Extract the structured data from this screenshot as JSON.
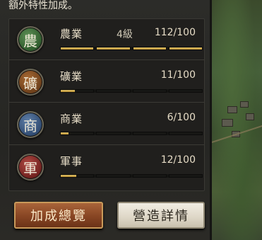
{
  "header": {
    "text": "額外特性加成。"
  },
  "rows": [
    {
      "icon": "農",
      "name": "農業",
      "level": "4級",
      "value": "112/100",
      "progress": 1.0,
      "color": "#3f6b3a"
    },
    {
      "icon": "礦",
      "name": "礦業",
      "level": "",
      "value": "11/100",
      "progress": 0.11,
      "color": "#7b4a23"
    },
    {
      "icon": "商",
      "name": "商業",
      "level": "",
      "value": "6/100",
      "progress": 0.06,
      "color": "#3c5678"
    },
    {
      "icon": "軍",
      "name": "軍事",
      "level": "",
      "value": "12/100",
      "progress": 0.12,
      "color": "#8a2f2b"
    }
  ],
  "buttons": {
    "summary": "加成總覽",
    "details": "營造詳情"
  }
}
